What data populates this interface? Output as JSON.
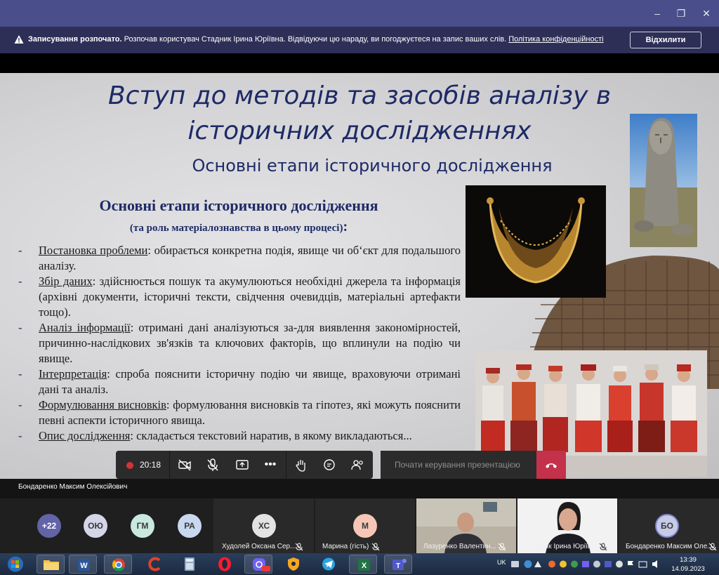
{
  "window": {
    "controls": {
      "minimize": "–",
      "restore": "❐",
      "close": "✕"
    }
  },
  "banner": {
    "bold_text": "Записування розпочато.",
    "text": " Розпочав користувач Стадник Ірина Юріївна. Відвідуючи цю нараду, ви погоджуєтеся на запис ваших слів. ",
    "privacy_link": "Політика конфіденційності",
    "decline_button": "Відхилити"
  },
  "slide": {
    "title_line1": "Вступ до методів та засобів аналізу в",
    "title_line2": "історичних дослідженнях",
    "subtitle": "Основні етапи історичного дослідження",
    "section_heading": "Основні етапи історичного дослідження",
    "section_sub": "(та роль матеріалознавства в цьому процесі)",
    "section_sub_colon": ":",
    "steps": [
      {
        "term": "Постановка проблеми",
        "text": ": обирається конкретна подія, явище чи об‘єкт для подальшого аналізу."
      },
      {
        "term": "Збір даних",
        "text": ": здійснюється пошук та акумулюються необхідні джерела та інформація (архівні документи, історичні тексти, свідчення очевидців, матеріальні артефакти тощо)."
      },
      {
        "term": "Аналіз інформації",
        "text": ": отримані дані аналізуються за-для виявлення закономірностей, причинно-наслідкових зв'язків та ключових факторів, що вплинули на подію чи явище."
      },
      {
        "term": "Інтерпретація",
        "text": ": спроба пояснити історичну подію чи явище, враховуючи отримані дані та аналіз."
      },
      {
        "term": "Формулювання висновків",
        "text": ": формулювання висновків та гіпотез, які можуть пояснити певні аспекти історичного явища."
      },
      {
        "term": "Опис дослідження",
        "text": ": складається текстовий наратив, в якому викладаються..."
      }
    ]
  },
  "toolbar": {
    "recording_time": "20:18",
    "presentation_placeholder": "Почати керування презентацією"
  },
  "presenter": {
    "name": "Бондаренко Максим Олексійович"
  },
  "participants": {
    "more_count": "+22",
    "avatars": [
      "ОЮ",
      "ГМ",
      "РА"
    ],
    "tiles": [
      {
        "initials": "ХС",
        "name": "Худолей Оксана Сер...",
        "color": "#e3e3e3"
      },
      {
        "initials": "М",
        "name": "Марина (гість)",
        "color": "#f6c7b6"
      },
      {
        "initials": "",
        "name": "Лазуренко Валентин...",
        "color": ""
      },
      {
        "initials": "",
        "name": "Стадник Ірина Юріїв...",
        "color": ""
      },
      {
        "initials": "БО",
        "name": "Бондаренко Максим Оле...",
        "color": "#c6cbe8"
      }
    ],
    "avatar_colors": {
      "more": "#6264a7",
      "ОЮ": "#d5d5e8",
      "ГМ": "#c9e8e0",
      "РА": "#c8d8f0"
    }
  },
  "taskbar": {
    "language": "UK",
    "time": "13:39",
    "date": "14.09.2023",
    "apps": [
      "start",
      "file-explorer",
      "word",
      "chrome",
      "ccleaner",
      "calculator",
      "opera",
      "viber",
      "vpn",
      "telegram",
      "excel",
      "teams"
    ]
  }
}
